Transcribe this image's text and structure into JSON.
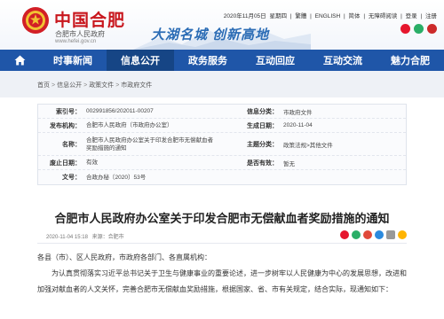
{
  "header": {
    "site_name": "中国合肥",
    "site_sub": "合肥市人民政府",
    "site_url": "www.hefei.gov.cn",
    "slogan": "大湖名城  创新高地",
    "date": "2020年11月05日",
    "weekday": "星期四",
    "links": [
      "繁體",
      "ENGLISH",
      "简体",
      "无障碍阅读",
      "登录",
      "注册"
    ],
    "separator": "|",
    "social_icons": [
      "weibo-icon",
      "wechat-icon",
      "app-icon"
    ]
  },
  "nav": {
    "home_icon": "home-icon",
    "items": [
      {
        "label": "时事新闻",
        "active": false
      },
      {
        "label": "信息公开",
        "active": true
      },
      {
        "label": "政务服务",
        "active": false
      },
      {
        "label": "互动回应",
        "active": false
      },
      {
        "label": "互动交流",
        "active": false
      },
      {
        "label": "魅力合肥",
        "active": false
      }
    ]
  },
  "breadcrumb": {
    "items": [
      "首页",
      "信息公开",
      "政策文件",
      "市政府文件"
    ],
    "separator": ">"
  },
  "info": {
    "rows": [
      {
        "k1": "索引号：",
        "v1": "002991856/202011-00207",
        "k2": "信息分类：",
        "v2": "市政府文件"
      },
      {
        "k1": "发布机构：",
        "v1": "合肥市人民政府（市政府办公室）",
        "k2": "生成日期：",
        "v2": "2020-11-04"
      },
      {
        "k1": "名称：",
        "v1": "合肥市人民政府办公室关于印发合肥市无偿献血者奖励措施的通知",
        "k2": "主题分类：",
        "v2": "政策法规>其他文件"
      },
      {
        "k1": "废止日期：",
        "v1": "有效",
        "k2": "是否有效：",
        "v2": "暂无"
      },
      {
        "k1": "文号：",
        "v1": "合政办秘〔2020〕53号",
        "k2": "",
        "v2": ""
      }
    ]
  },
  "doc": {
    "title": "合肥市人民政府办公室关于印发合肥市无偿献血者奖励措施的通知",
    "date": "2020-11-04 15:18",
    "source_label": "来源：",
    "source": "合肥市",
    "share_icons": [
      "weibo-share-icon",
      "wechat-share-icon",
      "renren-share-icon",
      "qq-share-icon",
      "print-icon",
      "more-share-icon"
    ],
    "greeting": "各县（市）、区人民政府，市政府各部门、各直属机构：",
    "paragraph": "为认真贯彻落实习近平总书记关于卫生与健康事业的重要论述，进一步树牢以人民健康为中心的发展思想，改进和加强对献血者的人文关怀，完善合肥市无偿献血奖励措施，根据国家、省、市有关规定，结合实际，现通知如下："
  }
}
